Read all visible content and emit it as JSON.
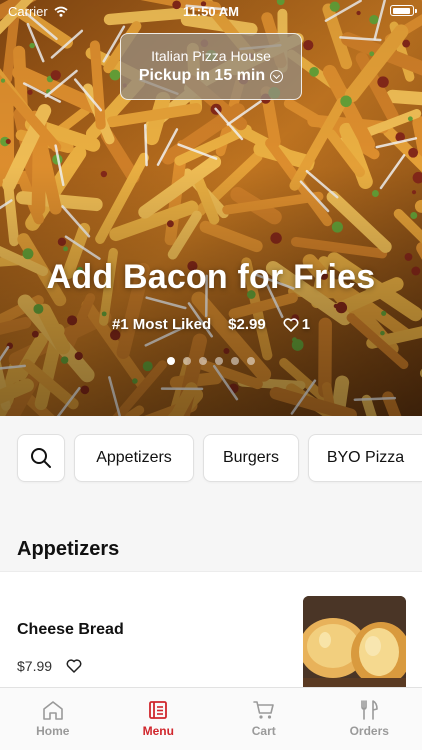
{
  "status_bar": {
    "carrier": "Carrier",
    "time": "11:50 AM"
  },
  "pickup": {
    "restaurant": "Italian Pizza House",
    "eta": "Pickup in 15 min"
  },
  "promo": {
    "title": "Add Bacon for Fries",
    "badge": "#1 Most Liked",
    "price": "$2.99",
    "likes": "1",
    "slide_count": 6,
    "active_slide": 1
  },
  "categories": [
    {
      "label": "Appetizers"
    },
    {
      "label": "Burgers"
    },
    {
      "label": "BYO Pizza"
    }
  ],
  "section": {
    "title": "Appetizers"
  },
  "item": {
    "name": "Cheese Bread",
    "price": "$7.99"
  },
  "tabs": [
    {
      "label": "Home",
      "icon": "home-icon"
    },
    {
      "label": "Menu",
      "icon": "menu-icon"
    },
    {
      "label": "Cart",
      "icon": "cart-icon"
    },
    {
      "label": "Orders",
      "icon": "orders-icon"
    }
  ],
  "colors": {
    "accent": "#d0262c",
    "inactive": "#9a9a9a"
  }
}
